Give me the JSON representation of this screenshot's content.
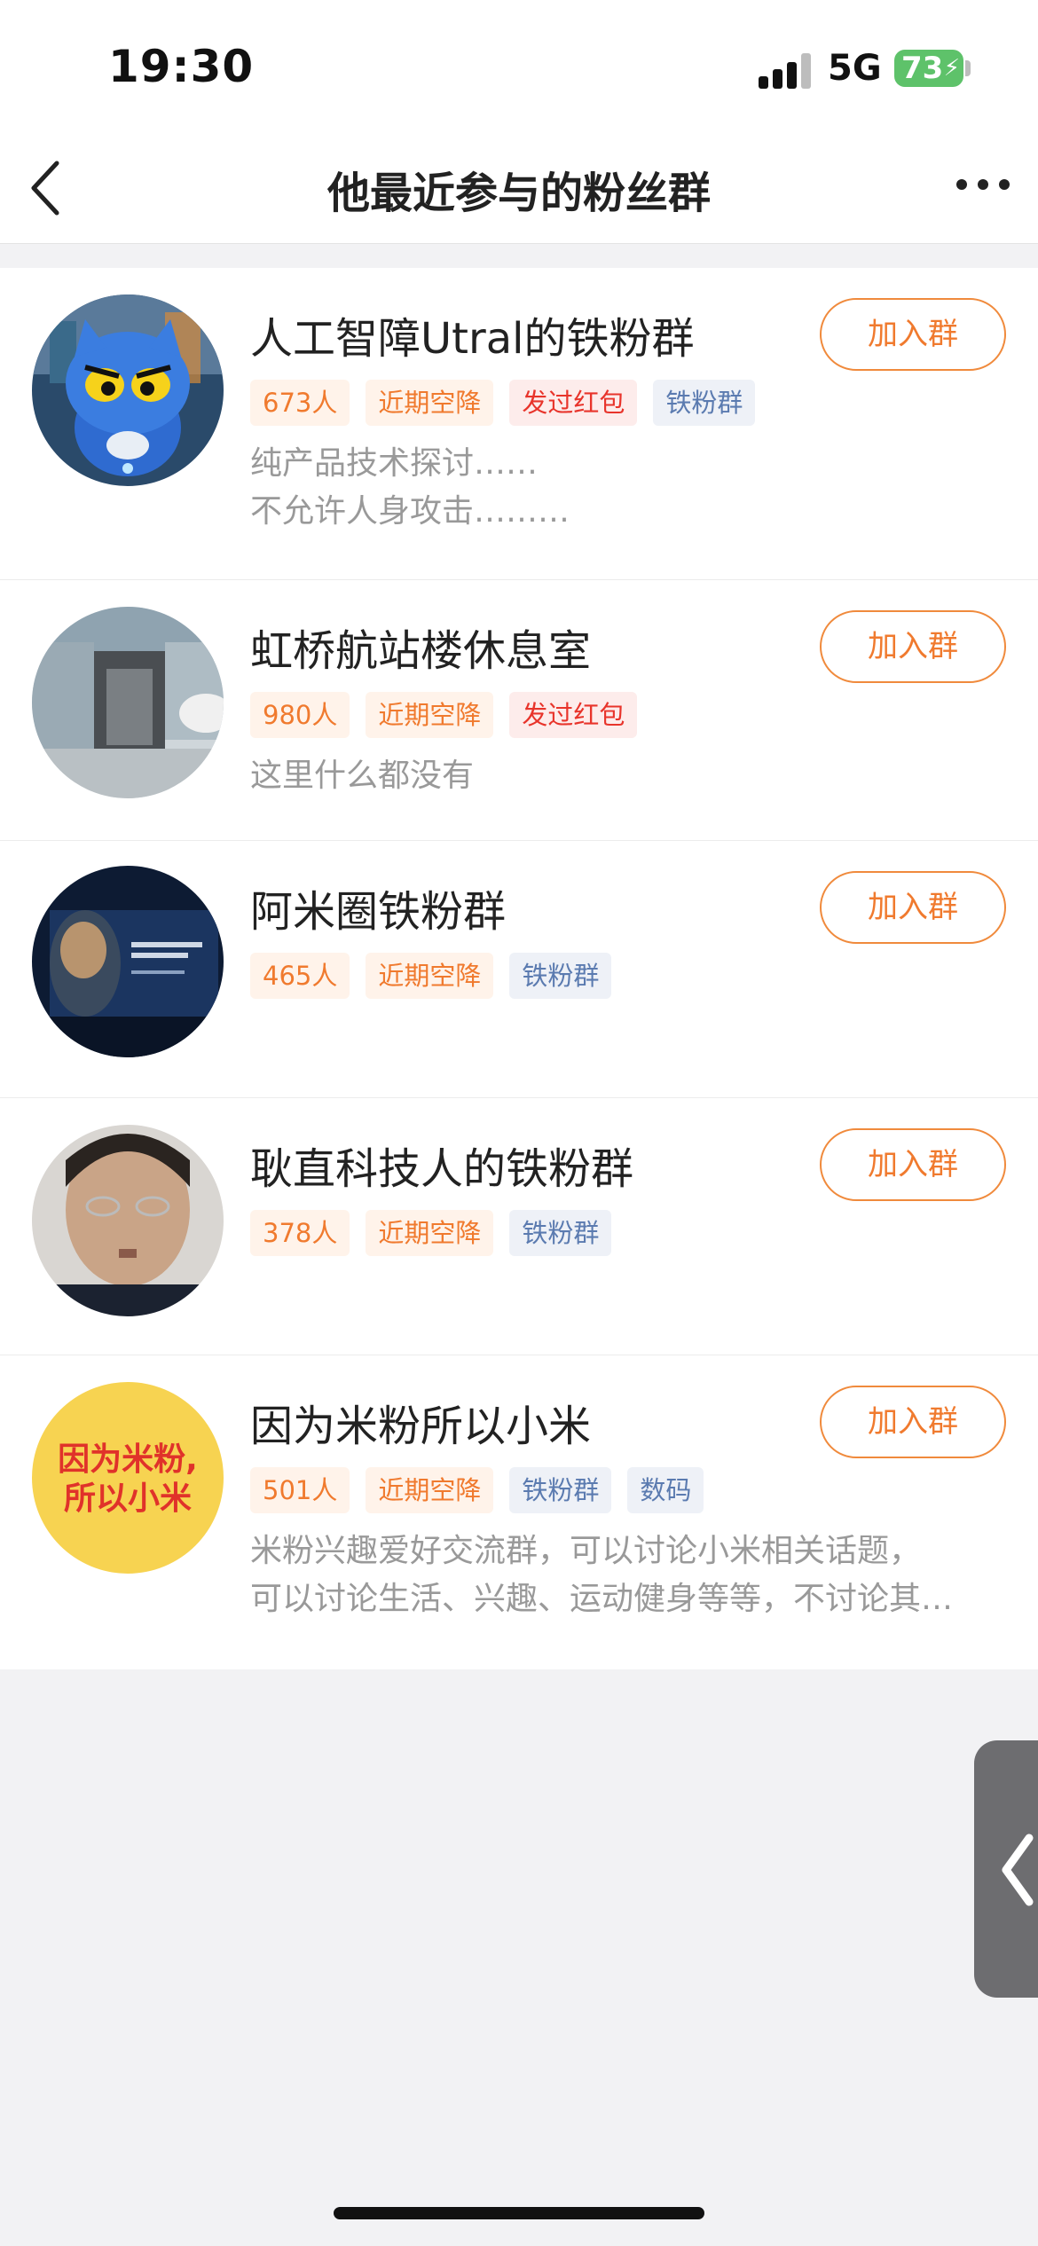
{
  "status_bar": {
    "time": "19:30",
    "network": "5G",
    "battery": "73"
  },
  "nav": {
    "title": "他最近参与的粉丝群"
  },
  "groups": [
    {
      "name": "人工智障Utral的铁粉群",
      "member_count": "673人",
      "tags": [
        {
          "label": "近期空降",
          "style": "orange"
        },
        {
          "label": "发过红包",
          "style": "red"
        },
        {
          "label": "铁粉群",
          "style": "blue"
        }
      ],
      "desc_lines": [
        "纯产品技术探讨……",
        "不允许人身攻击………"
      ],
      "join_label": "加入群",
      "avatar_icon": "blue-cat-character-avatar"
    },
    {
      "name": "虹桥航站楼休息室",
      "member_count": "980人",
      "tags": [
        {
          "label": "近期空降",
          "style": "orange"
        },
        {
          "label": "发过红包",
          "style": "red"
        }
      ],
      "desc_lines": [
        "这里什么都没有"
      ],
      "join_label": "加入群",
      "avatar_icon": "showroom-avatar"
    },
    {
      "name": "阿米圈铁粉群",
      "member_count": "465人",
      "tags": [
        {
          "label": "近期空降",
          "style": "orange"
        },
        {
          "label": "铁粉群",
          "style": "blue"
        }
      ],
      "desc_lines": [],
      "join_label": "加入群",
      "avatar_icon": "stage-portrait-avatar"
    },
    {
      "name": "耿直科技人的铁粉群",
      "member_count": "378人",
      "tags": [
        {
          "label": "近期空降",
          "style": "orange"
        },
        {
          "label": "铁粉群",
          "style": "blue"
        }
      ],
      "desc_lines": [],
      "join_label": "加入群",
      "avatar_icon": "person-photo-avatar"
    },
    {
      "name": "因为米粉所以小米",
      "member_count": "501人",
      "tags": [
        {
          "label": "近期空降",
          "style": "orange"
        },
        {
          "label": "铁粉群",
          "style": "blue"
        },
        {
          "label": "数码",
          "style": "blue"
        }
      ],
      "desc_lines": [
        "米粉兴趣爱好交流群，可以讨论小米相关话题，",
        "可以讨论生活、兴趣、运动健身等等，不讨论其…"
      ],
      "join_label": "加入群",
      "avatar_icon": "text-logo-avatar",
      "avatar_text": [
        "因为米粉,",
        "所以小米"
      ]
    }
  ],
  "colors": {
    "accent": "#f07a2e",
    "red_tag": "#e8342b",
    "blue_tag": "#5b7bb0",
    "background": "#f2f2f4"
  }
}
